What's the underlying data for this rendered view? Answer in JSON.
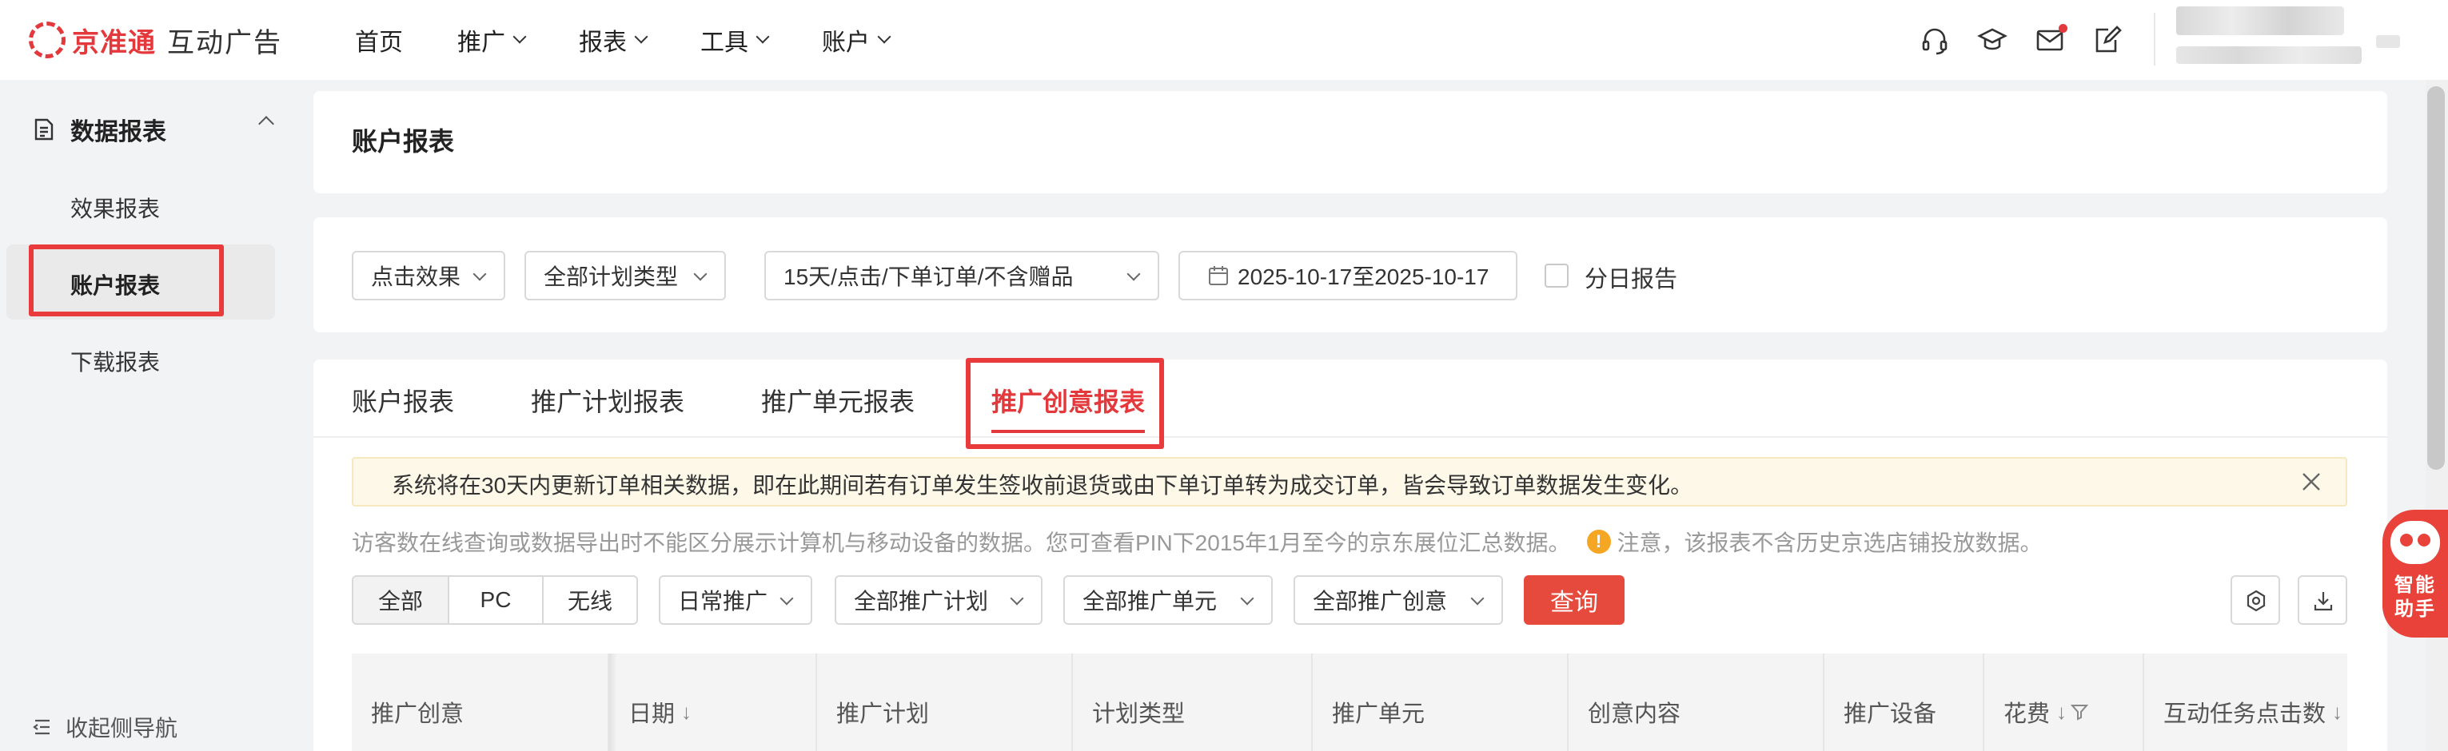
{
  "brand": {
    "name": "京准通",
    "product": "互动广告",
    "color": "#e4393c"
  },
  "nav": {
    "items": [
      {
        "label": "首页",
        "dropdown": false
      },
      {
        "label": "推广",
        "dropdown": true
      },
      {
        "label": "报表",
        "dropdown": true
      },
      {
        "label": "工具",
        "dropdown": true
      },
      {
        "label": "账户",
        "dropdown": true
      }
    ],
    "icons": [
      "headset-icon",
      "graduation-cap-icon",
      "mail-icon",
      "edit-note-icon"
    ]
  },
  "sidebar": {
    "group_label": "数据报表",
    "items": [
      {
        "label": "效果报表",
        "active": false
      },
      {
        "label": "账户报表",
        "active": true
      },
      {
        "label": "下载报表",
        "active": false
      }
    ],
    "collapse_label": "收起侧导航"
  },
  "page": {
    "title": "账户报表"
  },
  "filters": {
    "effect": "点击效果",
    "plan_type": "全部计划类型",
    "attribution": "15天/点击/下单订单/不含赠品",
    "date_range": "2025-10-17至2025-10-17",
    "daily_report_label": "分日报告",
    "daily_report_checked": false
  },
  "tabs": [
    {
      "label": "账户报表",
      "active": false
    },
    {
      "label": "推广计划报表",
      "active": false
    },
    {
      "label": "推广单元报表",
      "active": false
    },
    {
      "label": "推广创意报表",
      "active": true
    }
  ],
  "notice": {
    "text": "系统将在30天内更新订单相关数据，即在此期间若有订单发生签收前退货或由下单订单转为成交订单，皆会导致订单数据发生变化。"
  },
  "info": {
    "text": "访客数在线查询或数据导出时不能区分展示计算机与移动设备的数据。您可查看PIN下2015年1月至今的京东展位汇总数据。",
    "warning": "注意，该报表不含历史京选店铺投放数据。"
  },
  "toolbar": {
    "devices": [
      {
        "label": "全部",
        "selected": true
      },
      {
        "label": "PC",
        "selected": false
      },
      {
        "label": "无线",
        "selected": false
      }
    ],
    "promo_type": "日常推广",
    "all_plans": "全部推广计划",
    "all_units": "全部推广单元",
    "all_creatives": "全部推广创意",
    "query_label": "查询"
  },
  "table": {
    "columns": [
      {
        "label": "推广创意",
        "sort": false,
        "filter": false
      },
      {
        "label": "日期",
        "sort": true,
        "filter": false
      },
      {
        "label": "推广计划",
        "sort": false,
        "filter": false
      },
      {
        "label": "计划类型",
        "sort": false,
        "filter": false
      },
      {
        "label": "推广单元",
        "sort": false,
        "filter": false
      },
      {
        "label": "创意内容",
        "sort": false,
        "filter": false
      },
      {
        "label": "推广设备",
        "sort": false,
        "filter": false
      },
      {
        "label": "花费",
        "sort": true,
        "filter": true
      },
      {
        "label": "互动任务点击数",
        "sort": true,
        "filter": false
      }
    ]
  },
  "assistant": {
    "line1": "智能",
    "line2": "助手"
  },
  "colors": {
    "accent": "#e4393c",
    "query_button": "#e64a3c",
    "notice_bg": "#fdf8e8"
  }
}
